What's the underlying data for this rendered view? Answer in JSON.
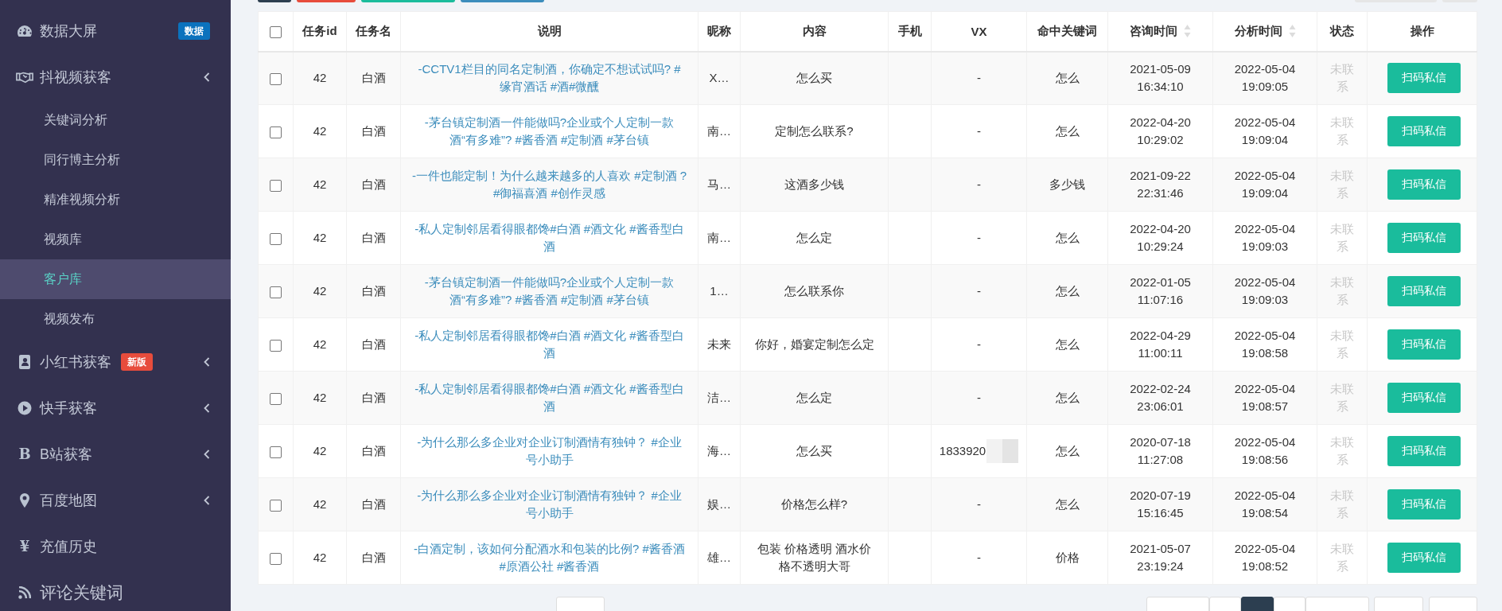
{
  "sidebar": {
    "items": [
      {
        "label": "数据大屏",
        "badge": {
          "text": "数据",
          "color": "#0b72bd"
        },
        "has_submenu": false,
        "selected": false
      },
      {
        "label": "抖视频获客",
        "has_submenu": true,
        "selected": false,
        "children": [
          {
            "label": "关键词分析",
            "selected": false
          },
          {
            "label": "同行博主分析",
            "selected": false
          },
          {
            "label": "精准视频分析",
            "selected": false
          },
          {
            "label": "视频库",
            "selected": false
          },
          {
            "label": "客户库",
            "selected": true
          },
          {
            "label": "视频发布",
            "selected": false
          }
        ]
      },
      {
        "label": "小红书获客",
        "badge": {
          "text": "新版",
          "color": "#e74c3c"
        },
        "has_submenu": true,
        "selected": false
      },
      {
        "label": "快手获客",
        "has_submenu": true,
        "selected": false
      },
      {
        "label": "B站获客",
        "icon_char": "B",
        "has_submenu": true,
        "selected": false
      },
      {
        "label": "百度地图",
        "has_submenu": true,
        "selected": false
      },
      {
        "label": "充值历史",
        "icon_char": "¥",
        "has_submenu": false,
        "selected": false
      },
      {
        "label": "评论关键词",
        "has_submenu": false,
        "selected": false
      }
    ]
  },
  "table": {
    "columns": [
      {
        "kind": "check",
        "checked": false
      },
      {
        "label": "任务id",
        "sortable": false
      },
      {
        "label": "任务名",
        "sortable": false
      },
      {
        "label": "说明",
        "sortable": false
      },
      {
        "label": "昵称",
        "sortable": false
      },
      {
        "label": "内容",
        "sortable": false
      },
      {
        "label": "手机",
        "sortable": false
      },
      {
        "label": "VX",
        "sortable": false
      },
      {
        "label": "命中关键词",
        "sortable": false
      },
      {
        "label": "咨询时间",
        "sortable": true
      },
      {
        "label": "分析时间",
        "sortable": true
      },
      {
        "label": "状态",
        "sortable": false
      },
      {
        "label": "操作",
        "sortable": false
      }
    ],
    "rows": [
      {
        "checked": false,
        "task_id": "42",
        "task_name": "白酒",
        "description": "-CCTV1栏目的同名定制酒，你确定不想试试吗? #缘宵酒话 #酒#微醺",
        "nickname": "X…",
        "content": "怎么买",
        "vx": "-",
        "vx_redacted": false,
        "keyword": "怎么",
        "consult_time": "2021-05-09 16:34:10",
        "analysis_time": "2022-05-04 19:09:05",
        "status": "未联系",
        "contacted": false,
        "action": "扫码私信"
      },
      {
        "checked": false,
        "task_id": "42",
        "task_name": "白酒",
        "description": "-茅台镇定制酒一件能做吗?企业或个人定制一款酒“有多难”? #酱香酒 #定制酒 #茅台镇",
        "nickname": "南…",
        "content": "定制怎么联系?",
        "vx": "-",
        "vx_redacted": false,
        "keyword": "怎么",
        "consult_time": "2022-04-20 10:29:02",
        "analysis_time": "2022-05-04 19:09:04",
        "status": "未联系",
        "contacted": false,
        "action": "扫码私信"
      },
      {
        "checked": false,
        "task_id": "42",
        "task_name": "白酒",
        "description": "-一件也能定制！为什么越来越多的人喜欢 #定制酒 ? #御福喜酒 #创作灵感",
        "nickname": "马…",
        "content": "这酒多少钱",
        "vx": "-",
        "vx_redacted": false,
        "keyword": "多少钱",
        "consult_time": "2021-09-22 22:31:46",
        "analysis_time": "2022-05-04 19:09:04",
        "status": "未联系",
        "contacted": false,
        "action": "扫码私信"
      },
      {
        "checked": false,
        "task_id": "42",
        "task_name": "白酒",
        "description": "-私人定制邻居看得眼都馋#白酒 #酒文化 #酱香型白酒",
        "nickname": "南…",
        "content": "怎么定",
        "vx": "-",
        "vx_redacted": false,
        "keyword": "怎么",
        "consult_time": "2022-04-20 10:29:24",
        "analysis_time": "2022-05-04 19:09:03",
        "status": "未联系",
        "contacted": false,
        "action": "扫码私信"
      },
      {
        "checked": false,
        "task_id": "42",
        "task_name": "白酒",
        "description": "-茅台镇定制酒一件能做吗?企业或个人定制一款酒“有多难”? #酱香酒 #定制酒 #茅台镇",
        "nickname": "1…",
        "content": "怎么联系你",
        "vx": "-",
        "vx_redacted": false,
        "keyword": "怎么",
        "consult_time": "2022-01-05 11:07:16",
        "analysis_time": "2022-05-04 19:09:03",
        "status": "未联系",
        "contacted": false,
        "action": "扫码私信"
      },
      {
        "checked": false,
        "task_id": "42",
        "task_name": "白酒",
        "description": "-私人定制邻居看得眼都馋#白酒 #酒文化 #酱香型白酒",
        "nickname": "未来",
        "content": "你好，婚宴定制怎么定",
        "vx": "-",
        "vx_redacted": false,
        "keyword": "怎么",
        "consult_time": "2022-04-29 11:00:11",
        "analysis_time": "2022-05-04 19:08:58",
        "status": "未联系",
        "contacted": false,
        "action": "扫码私信"
      },
      {
        "checked": false,
        "task_id": "42",
        "task_name": "白酒",
        "description": "-私人定制邻居看得眼都馋#白酒 #酒文化 #酱香型白酒",
        "nickname": "洁…",
        "content": "怎么定",
        "vx": "-",
        "vx_redacted": false,
        "keyword": "怎么",
        "consult_time": "2022-02-24 23:06:01",
        "analysis_time": "2022-05-04 19:08:57",
        "status": "未联系",
        "contacted": false,
        "action": "扫码私信"
      },
      {
        "checked": false,
        "task_id": "42",
        "task_name": "白酒",
        "description": "-为什么那么多企业对企业订制酒情有独钟？ #企业号小助手",
        "nickname": "海…",
        "content": "怎么买",
        "vx": "1833920",
        "vx_redacted": true,
        "keyword": "怎么",
        "consult_time": "2020-07-18 11:27:08",
        "analysis_time": "2022-05-04 19:08:56",
        "status": "未联系",
        "contacted": false,
        "action": "扫码私信"
      },
      {
        "checked": false,
        "task_id": "42",
        "task_name": "白酒",
        "description": "-为什么那么多企业对企业订制酒情有独钟？ #企业号小助手",
        "nickname": "娱…",
        "content": "价格怎么样?",
        "vx": "-",
        "vx_redacted": false,
        "keyword": "怎么",
        "consult_time": "2020-07-19 15:16:45",
        "analysis_time": "2022-05-04 19:08:54",
        "status": "未联系",
        "contacted": false,
        "action": "扫码私信"
      },
      {
        "checked": false,
        "task_id": "42",
        "task_name": "白酒",
        "description": "-白酒定制，该如何分配酒水和包装的比例? #酱香酒 #原酒公社 #酱香酒",
        "nickname": "雄…",
        "content": "包装 价格透明 酒水价格不透明大哥",
        "vx": "-",
        "vx_redacted": false,
        "keyword": "价格",
        "consult_time": "2021-05-07 23:19:24",
        "analysis_time": "2022-05-04 19:08:52",
        "status": "未联系",
        "contacted": false,
        "action": "扫码私信"
      }
    ]
  }
}
